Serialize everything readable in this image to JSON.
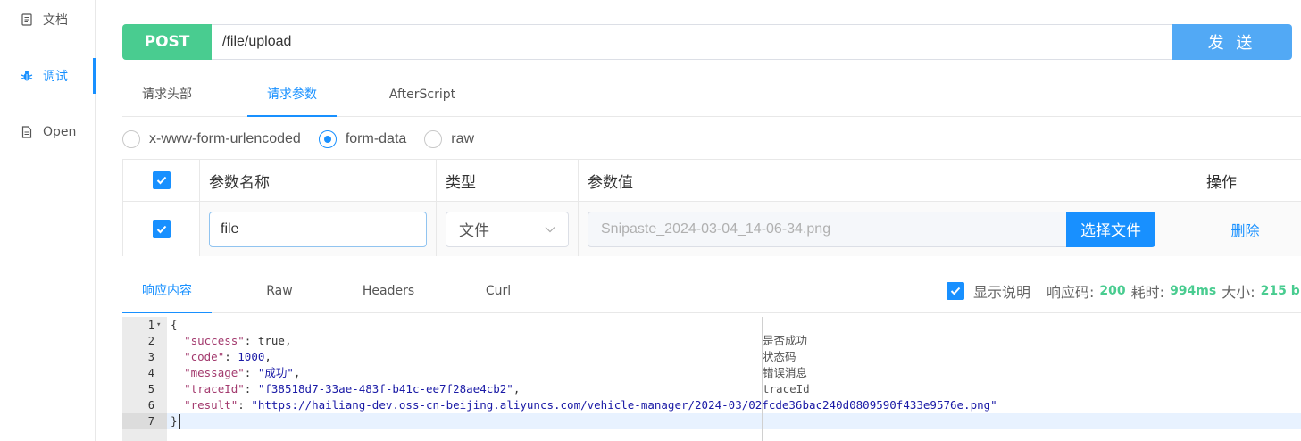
{
  "sidebar": {
    "items": [
      {
        "label": "文档",
        "icon": "document-icon"
      },
      {
        "label": "调试",
        "icon": "bug-icon",
        "active": true
      },
      {
        "label": "Open",
        "icon": "file-icon"
      }
    ]
  },
  "request": {
    "method": "POST",
    "url": "/file/upload",
    "send_label": "发 送"
  },
  "req_tabs": [
    {
      "label": "请求头部"
    },
    {
      "label": "请求参数",
      "active": true
    },
    {
      "label": "AfterScript"
    }
  ],
  "body_types": [
    {
      "label": "x-www-form-urlencoded",
      "checked": false
    },
    {
      "label": "form-data",
      "checked": true
    },
    {
      "label": "raw",
      "checked": false
    }
  ],
  "params_table": {
    "headers": [
      "参数名称",
      "类型",
      "参数值",
      "操作"
    ],
    "rows": [
      {
        "checked": true,
        "name": "file",
        "type": "文件",
        "value": "Snipaste_2024-03-04_14-06-34.png",
        "choose_file_label": "选择文件",
        "delete_label": "删除"
      }
    ]
  },
  "resp_tabs": [
    {
      "label": "响应内容",
      "active": true
    },
    {
      "label": "Raw"
    },
    {
      "label": "Headers"
    },
    {
      "label": "Curl"
    }
  ],
  "resp_meta": {
    "show_desc_label": "显示说明",
    "show_desc_checked": true,
    "code_label": "响应码:",
    "code_value": "200",
    "time_label": "耗时:",
    "time_value": "994ms",
    "size_label": "大小:",
    "size_value": "215 b"
  },
  "response": {
    "line_numbers": [
      "1",
      "2",
      "3",
      "4",
      "5",
      "6",
      "7"
    ],
    "open_brace": "{",
    "close_brace": "}",
    "fields": [
      {
        "key": "\"success\"",
        "sep": ": ",
        "value": "true",
        "tail": ",",
        "note": "是否成功"
      },
      {
        "key": "\"code\"",
        "sep": ": ",
        "value": "1000",
        "tail": ",",
        "note": "状态码"
      },
      {
        "key": "\"message\"",
        "sep": ": ",
        "value": "\"成功\"",
        "tail": ",",
        "note": "错误消息"
      },
      {
        "key": "\"traceId\"",
        "sep": ": ",
        "value": "\"f38518d7-33ae-483f-b41c-ee7f28ae4cb2\"",
        "tail": ",",
        "note": "traceId"
      },
      {
        "key": "\"result\"",
        "sep": ": ",
        "value": "\"https://hailiang-dev.oss-cn-beijing.aliyuncs.com/vehicle-manager/2024-03/02fcde36bac240d0809590f433e9576e.png\"",
        "tail": "",
        "note": ""
      }
    ]
  },
  "colors": {
    "accent": "#1890ff",
    "post_method": "#49cc90",
    "send_button": "#52a9f5"
  }
}
